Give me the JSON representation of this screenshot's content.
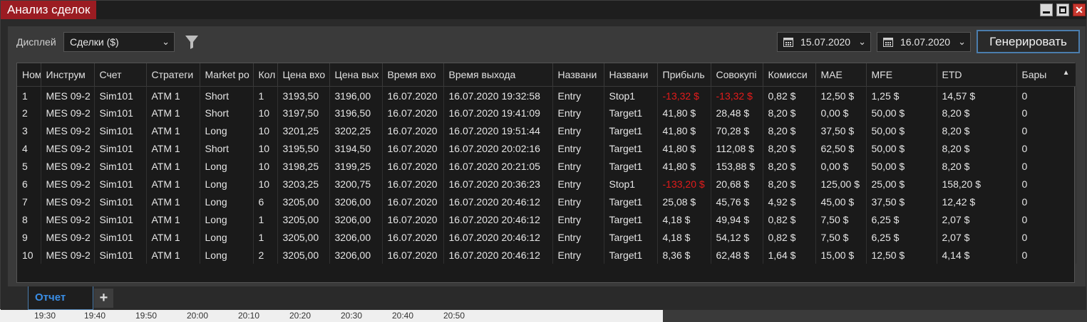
{
  "window": {
    "title": "Анализ сделок"
  },
  "toolbar": {
    "display_label": "Дисплей",
    "display_value": "Сделки ($)",
    "date_from": "15.07.2020",
    "date_to": "16.07.2020",
    "generate_label": "Генерировать"
  },
  "table": {
    "columns": [
      "Ном",
      "Инструм",
      "Счет",
      "Стратеги",
      "Market po",
      "Кол",
      "Цена вхо",
      "Цена вых",
      "Время вхо",
      "Время выхода",
      "Названи",
      "Названи",
      "Прибыль",
      "Совокупі",
      "Комисси",
      "MAE",
      "MFE",
      "ETD",
      "Бары"
    ],
    "rows": [
      [
        "1",
        "MES 09-2",
        "Sim101",
        "ATM 1",
        "Short",
        "1",
        "3193,50",
        "3196,00",
        "16.07.2020",
        "16.07.2020 19:32:58",
        "Entry",
        "Stop1",
        "-13,32 $",
        "-13,32 $",
        "0,82 $",
        "12,50 $",
        "1,25 $",
        "14,57 $",
        "0"
      ],
      [
        "2",
        "MES 09-2",
        "Sim101",
        "ATM 1",
        "Short",
        "10",
        "3197,50",
        "3196,50",
        "16.07.2020",
        "16.07.2020 19:41:09",
        "Entry",
        "Target1",
        "41,80 $",
        "28,48 $",
        "8,20 $",
        "0,00 $",
        "50,00 $",
        "8,20 $",
        "0"
      ],
      [
        "3",
        "MES 09-2",
        "Sim101",
        "ATM 1",
        "Long",
        "10",
        "3201,25",
        "3202,25",
        "16.07.2020",
        "16.07.2020 19:51:44",
        "Entry",
        "Target1",
        "41,80 $",
        "70,28 $",
        "8,20 $",
        "37,50 $",
        "50,00 $",
        "8,20 $",
        "0"
      ],
      [
        "4",
        "MES 09-2",
        "Sim101",
        "ATM 1",
        "Short",
        "10",
        "3195,50",
        "3194,50",
        "16.07.2020",
        "16.07.2020 20:02:16",
        "Entry",
        "Target1",
        "41,80 $",
        "112,08 $",
        "8,20 $",
        "62,50 $",
        "50,00 $",
        "8,20 $",
        "0"
      ],
      [
        "5",
        "MES 09-2",
        "Sim101",
        "ATM 1",
        "Long",
        "10",
        "3198,25",
        "3199,25",
        "16.07.2020",
        "16.07.2020 20:21:05",
        "Entry",
        "Target1",
        "41,80 $",
        "153,88 $",
        "8,20 $",
        "0,00 $",
        "50,00 $",
        "8,20 $",
        "0"
      ],
      [
        "6",
        "MES 09-2",
        "Sim101",
        "ATM 1",
        "Long",
        "10",
        "3203,25",
        "3200,75",
        "16.07.2020",
        "16.07.2020 20:36:23",
        "Entry",
        "Stop1",
        "-133,20 $",
        "20,68 $",
        "8,20 $",
        "125,00 $",
        "25,00 $",
        "158,20 $",
        "0"
      ],
      [
        "7",
        "MES 09-2",
        "Sim101",
        "ATM 1",
        "Long",
        "6",
        "3205,00",
        "3206,00",
        "16.07.2020",
        "16.07.2020 20:46:12",
        "Entry",
        "Target1",
        "25,08 $",
        "45,76 $",
        "4,92 $",
        "45,00 $",
        "37,50 $",
        "12,42 $",
        "0"
      ],
      [
        "8",
        "MES 09-2",
        "Sim101",
        "ATM 1",
        "Long",
        "1",
        "3205,00",
        "3206,00",
        "16.07.2020",
        "16.07.2020 20:46:12",
        "Entry",
        "Target1",
        "4,18 $",
        "49,94 $",
        "0,82 $",
        "7,50 $",
        "6,25 $",
        "2,07 $",
        "0"
      ],
      [
        "9",
        "MES 09-2",
        "Sim101",
        "ATM 1",
        "Long",
        "1",
        "3205,00",
        "3206,00",
        "16.07.2020",
        "16.07.2020 20:46:12",
        "Entry",
        "Target1",
        "4,18 $",
        "54,12 $",
        "0,82 $",
        "7,50 $",
        "6,25 $",
        "2,07 $",
        "0"
      ],
      [
        "10",
        "MES 09-2",
        "Sim101",
        "ATM 1",
        "Long",
        "2",
        "3205,00",
        "3206,00",
        "16.07.2020",
        "16.07.2020 20:46:12",
        "Entry",
        "Target1",
        "8,36 $",
        "62,48 $",
        "1,64 $",
        "15,00 $",
        "12,50 $",
        "4,14 $",
        "0"
      ]
    ]
  },
  "tabs": {
    "report_label": "Отчет",
    "add_label": "+"
  },
  "background_axis": {
    "ticks": [
      "19:30",
      "19:40",
      "19:50",
      "20:00",
      "20:10",
      "20:20",
      "20:30",
      "20:40",
      "20:50"
    ]
  },
  "colors": {
    "title_accent": "#9b1c22",
    "negative": "#e41b1b",
    "tab_active": "#3a8ee6",
    "focus_border": "#4b7dad"
  }
}
